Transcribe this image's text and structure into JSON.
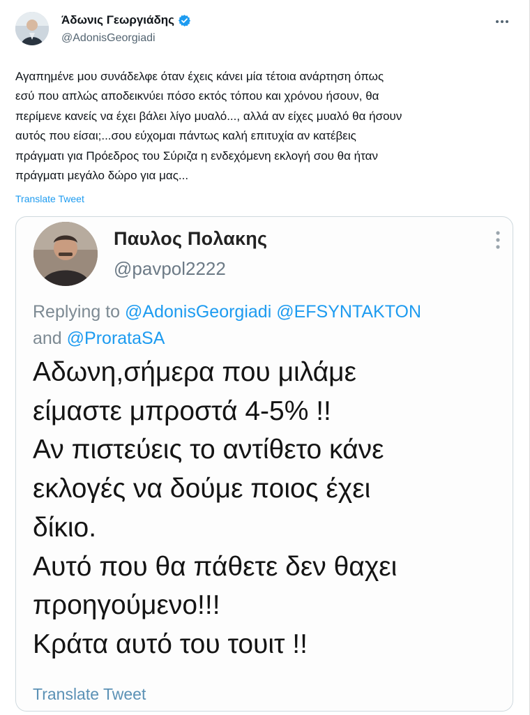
{
  "tweet": {
    "author_name": "Άδωνις Γεωργιάδης",
    "author_handle": "@AdonisGeorgiadi",
    "body": "Αγαπημένε μου συνάδελφε όταν έχεις κάνει μία τέτοια ανάρτηση όπως\nεσύ που απλώς αποδεικνύει πόσο εκτός τόπου και χρόνου ήσουν, θα\nπερίμενε κανείς να έχει βάλει λίγο μυαλό..., αλλά αν είχες μυαλό θα ήσουν\nαυτός που είσαι;...σου εύχομαι πάντως καλή επιτυχία αν κατέβεις\nπράγματι για Πρόεδρος του Σύριζα η ενδεχόμενη εκλογή σου θα ήταν\nπράγματι μεγάλο δώρο για μας...",
    "translate_label": "Translate Tweet"
  },
  "quoted": {
    "author_name": "Παυλος Πολακης",
    "author_handle": "@pavpol2222",
    "replying_prefix": "Replying to ",
    "mention_1": "@AdonisGeorgiadi",
    "mention_2": "@EFSYNTAKTON",
    "and_word": "and ",
    "mention_3": "@ProrataSA",
    "body": "Αδωνη,σήμερα που μιλάμε\nείμαστε μπροστά 4-5% !!\nΑν πιστεύεις το αντίθετο κάνε\nεκλογές να δούμε ποιος έχει\nδίκιο.\nΑυτό που θα πάθετε δεν θαχει\nπροηγούμενο!!!\nΚράτα αυτό του τουιτ !!",
    "translate_label": "Translate Tweet"
  },
  "icons": {
    "verified": "verified-badge-icon",
    "more": "more-options-icon"
  },
  "colors": {
    "link": "#1d9bf0",
    "verified": "#1d9bf0",
    "secondary_text": "#536471"
  }
}
